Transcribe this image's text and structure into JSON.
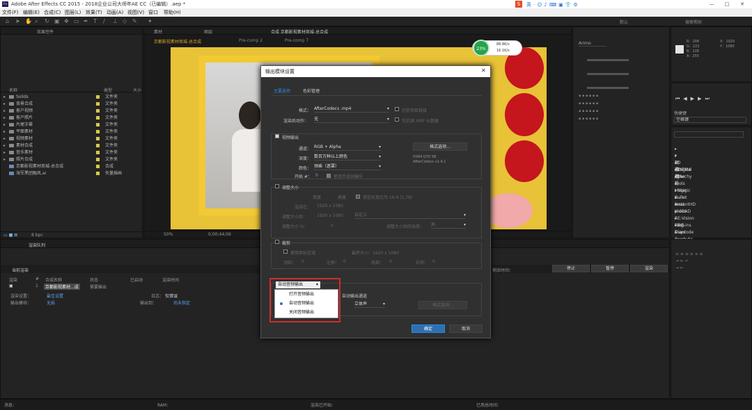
{
  "window": {
    "title": "Adobe After Effects CC 2015 - 2018企业公司大师年AE CC（已编辑）.aep *",
    "min": "—",
    "max": "□",
    "close": "✕"
  },
  "menu": [
    "文件(F)",
    "编辑(E)",
    "合成(C)",
    "图层(L)",
    "效果(T)",
    "动画(A)",
    "视图(V)",
    "窗口",
    "帮助(H)"
  ],
  "toolbar": {
    "right": "默认",
    "help": "搜索帮助"
  },
  "project": {
    "tab": "效果控件",
    "header": {
      "name": "名称",
      "type": "类型",
      "size": "大小"
    },
    "items": [
      {
        "name": "Solids",
        "type": "文件夹"
      },
      {
        "name": "背景合成",
        "type": "文件夹"
      },
      {
        "name": "客户视频",
        "type": "文件夹"
      },
      {
        "name": "客户照片",
        "type": "文件夹"
      },
      {
        "name": "片尾字幕",
        "type": "文件夹"
      },
      {
        "name": "平面素材",
        "type": "文件夹"
      },
      {
        "name": "视频素材",
        "type": "文件夹"
      },
      {
        "name": "素材合成",
        "type": "文件夹"
      },
      {
        "name": "音乐素材",
        "type": "文件夹"
      },
      {
        "name": "照片合成",
        "type": "文件夹"
      },
      {
        "name": "京都影视素材商城-总合成",
        "type": "合成"
      },
      {
        "name": "海军黑团融风.ai",
        "type": "矢量插画"
      }
    ],
    "footer": "8 bpc"
  },
  "comp": {
    "tabs": [
      "素材",
      "图层",
      "合成 京都影视素材商城-总合成"
    ],
    "breadcrumb": [
      "京都影视素材商城-总合成",
      "Pre-comp 2",
      "Pre-comp 7"
    ],
    "zoom": "50%",
    "timecode": "0;00;44;06"
  },
  "perf": {
    "cpu": "23%",
    "up": "88.8K/s",
    "down": "16.1K/s"
  },
  "info": {
    "r": "R：",
    "g": "G：",
    "b": "B：",
    "a": "A：",
    "x": "X：",
    "y": "Y：",
    "vals": [
      "208",
      "222",
      "228",
      "255",
      "1920",
      "1080"
    ]
  },
  "character": {
    "font": "Arimo"
  },
  "preview": {
    "label": "快捷键",
    "value": "空格键"
  },
  "effects": {
    "items": [
      "* 动画预设",
      "3D 通道",
      "CINEMA 4D",
      "Digital Anarchy",
      "JAe Tools",
      "Magic Bullet",
      "Magic Bullet InstantHD",
      "Neat Video",
      "proDAD",
      "RE:Vision Plug-ins",
      "Red Giant",
      "RG Trapcode",
      "Rowbyte"
    ]
  },
  "rq": {
    "tab": "渲染队列",
    "current": "当前渲染",
    "cols": [
      "渲染",
      "#",
      "合成名称",
      "状态",
      "已启动",
      "渲染时间"
    ],
    "row": {
      "num": "1",
      "comp": "京都影视素材...成",
      "status": "需要输出"
    },
    "settings": "渲染设置：",
    "settings_v": "最佳设置",
    "output": "输出模块：",
    "output_v": "无损",
    "log": "日志：",
    "log_v": "仅错误",
    "to": "输出到：",
    "to_v": "尚未指定",
    "remaining": "剩余时间：",
    "btns": [
      "停止",
      "暂停",
      "渲染"
    ]
  },
  "status": {
    "msg": "消息：",
    "ram": "RAM：",
    "started": "渲染已开始：",
    "elapsed": "已用总时间："
  },
  "dialog": {
    "title": "输出模块设置",
    "close": "✕",
    "tabs": [
      "主要选项",
      "色彩管理"
    ],
    "format_l": "格式：",
    "format_v": "AfterCodecs .mp4",
    "include_proj": "包括项目链接",
    "post_l": "渲染后动作：",
    "post_v": "无",
    "include_xmp": "包括源 XMP 元数据",
    "video_out": "视频输出",
    "channels_l": "通道：",
    "channels_v": "RGB + Alpha",
    "format_opts": "格式选项...",
    "depth_l": "深度：",
    "depth_v": "数百万种以上颜色",
    "codec_info": "H264 Q70 SB\nAfterCodecs v1.4.1",
    "color_l": "颜色：",
    "color_v": "预乘（遮罩）",
    "start_l": "开始 #：",
    "start_v": "0",
    "use_comp_frame": "使用合成帧编号",
    "resize": "调整大小",
    "w": "宽度",
    "h": "高度",
    "lock": "锁定长宽比为 16:9 (1.78)",
    "render_at": "渲染在：",
    "render_at_v": "1920 x 1080",
    "resize_to": "调整大小后：",
    "resize_to_v": "1920 x 1080",
    "custom": "自定义",
    "resize_pct": "调整大小 %：",
    "resize_pct_v": "x",
    "quality": "调整大小后的品质：",
    "quality_v": "高",
    "crop": "裁剪",
    "use_roi": "使用目标区域",
    "final": "最终大小：1920 x 1080",
    "top": "顶部：",
    "left": "左侧：",
    "bottom": "底部：",
    "right": "右侧：",
    "zero": "0",
    "audio_out_label": "音频输出",
    "auto_audio": "自动音频输出",
    "audio_opts": [
      "打开音频输出",
      "自动音频输出",
      "关闭音频输出"
    ],
    "audio_rate": "自动输出通道",
    "stereo": "立体声",
    "fmt2": "格式选项...",
    "ok": "确定",
    "cancel": "取消"
  },
  "colors": {
    "accent": "#2d8ceb",
    "highlight_box": "#d32b2b",
    "comp_bg": "#e8c237"
  }
}
